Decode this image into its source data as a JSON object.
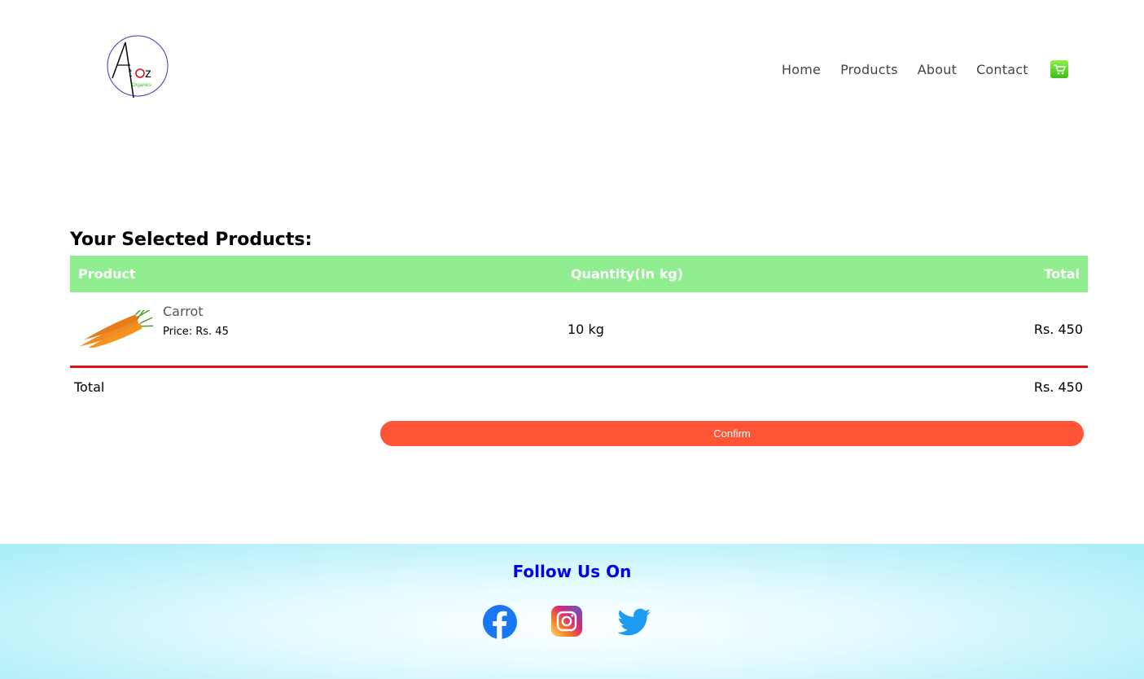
{
  "header": {
    "logo_text": "Atoz",
    "logo_subtext": "Organics",
    "nav": [
      "Home",
      "Products",
      "About",
      "Contact"
    ],
    "cart_icon": "shopping-cart-icon"
  },
  "main": {
    "section_title": "Your Selected Products:",
    "table": {
      "headers": {
        "product": "Product",
        "quantity": "Quantity(In kg)",
        "total": "Total"
      },
      "rows": [
        {
          "name": "Carrot",
          "price": "Price: Rs. 45",
          "quantity": "10 kg",
          "total": "Rs. 450",
          "image": "carrot-image"
        }
      ]
    },
    "summary": {
      "label": "Total",
      "value": "Rs. 450"
    },
    "confirm_label": "Confirm"
  },
  "footer": {
    "follow_text": "Follow Us On",
    "social": [
      "facebook-icon",
      "instagram-icon",
      "twitter-icon"
    ]
  },
  "colors": {
    "header_row": "#90ee90",
    "divider": "#e01010",
    "confirm": "#ff5436",
    "follow": "#0000ee",
    "cart": "#3bbf1a"
  }
}
